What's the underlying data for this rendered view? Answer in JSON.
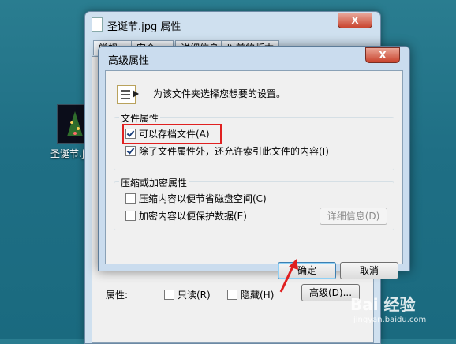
{
  "desktop": {
    "icon_label": "圣诞节.jpg"
  },
  "bg_window": {
    "title": "圣诞节.jpg 属性",
    "close_glyph": "X",
    "tabs": [
      "常规",
      "安全",
      "详细信息",
      "以前的版本"
    ],
    "attributes_label": "属性:",
    "readonly_label": "只读(R)",
    "hidden_label": "隐藏(H)",
    "advanced_button": "高级(D)..."
  },
  "advanced_dialog": {
    "title": "高级属性",
    "close_glyph": "X",
    "header_text": "为该文件夹选择您想要的设置。",
    "file_attributes": {
      "title": "文件属性",
      "archive_label": "可以存档文件(A)",
      "archive_checked": true,
      "index_label": "除了文件属性外，还允许索引此文件的内容(I)",
      "index_checked": true
    },
    "compress_encrypt": {
      "title": "压缩或加密属性",
      "compress_label": "压缩内容以便节省磁盘空间(C)",
      "compress_checked": false,
      "encrypt_label": "加密内容以便保护数据(E)",
      "encrypt_checked": false,
      "details_button": "详细信息(D)"
    },
    "ok_button": "确定",
    "cancel_button": "取消"
  },
  "watermark": {
    "logo": "Bai 经验",
    "url": "jingyan.baidu.com"
  },
  "colors": {
    "annotation_red": "#e02020",
    "desktop_bg": "#1f6f85"
  }
}
